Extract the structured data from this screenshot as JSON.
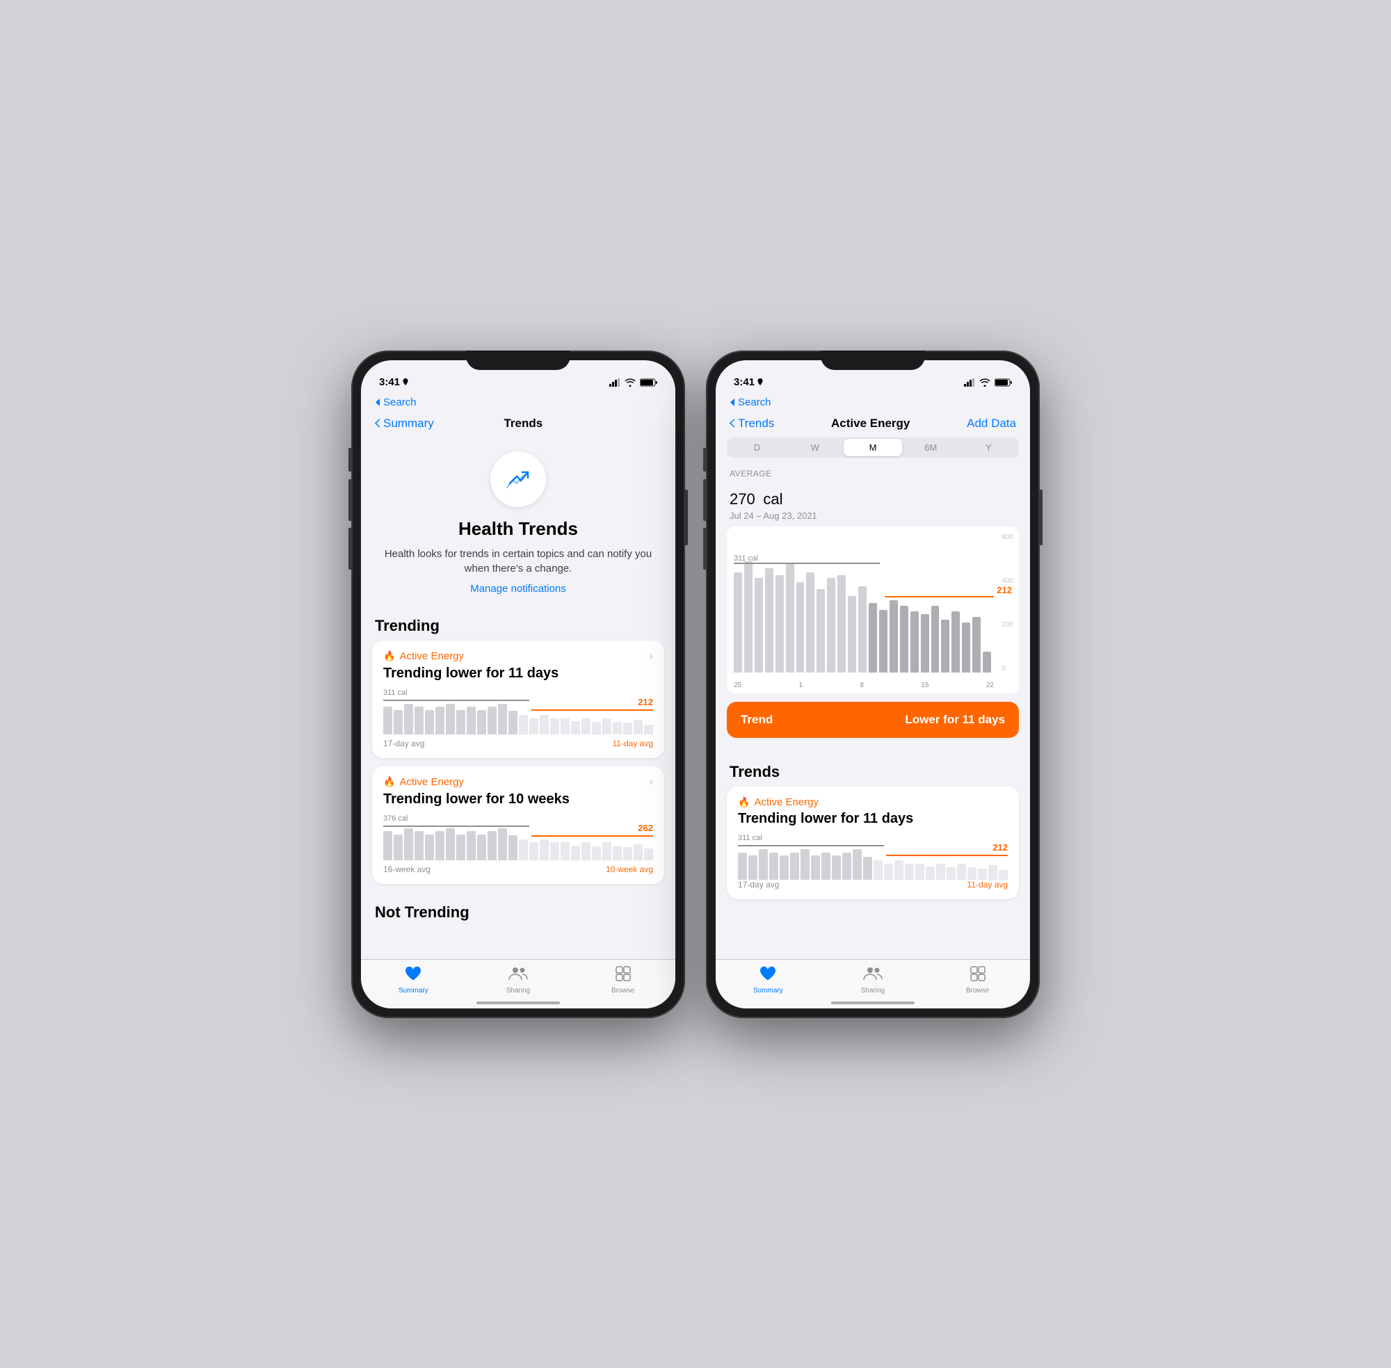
{
  "phone1": {
    "status": {
      "time": "3:41",
      "location_icon": true
    },
    "nav": {
      "back_label": "Summary",
      "title": "Trends"
    },
    "search": {
      "back_label": "Search"
    },
    "hero": {
      "title": "Health Trends",
      "description": "Health looks for trends in certain topics and can notify you when there's a change.",
      "link": "Manage notifications"
    },
    "trending_header": "Trending",
    "cards": [
      {
        "metric": "Active Energy",
        "description": "Trending lower for 11 days",
        "old_cal": "311 cal",
        "new_cal": "212",
        "old_avg": "17-day avg",
        "new_avg": "11-day avg",
        "bars": [
          7,
          6,
          8,
          7,
          6,
          7,
          8,
          6,
          7,
          6,
          7,
          8,
          6,
          5,
          4,
          5,
          4,
          4,
          3,
          4,
          3,
          4,
          3,
          3,
          4,
          3
        ]
      },
      {
        "metric": "Active Energy",
        "description": "Trending lower for 10 weeks",
        "old_cal": "376 cal",
        "new_cal": "262",
        "old_avg": "16-week avg",
        "new_avg": "10-week avg",
        "bars": [
          8,
          7,
          9,
          8,
          7,
          8,
          9,
          7,
          8,
          7,
          8,
          9,
          7,
          6,
          5,
          6,
          5,
          5,
          4,
          5,
          4,
          5,
          4,
          4,
          5,
          4
        ]
      }
    ],
    "not_trending_header": "Not Trending",
    "tabs": [
      {
        "label": "Summary",
        "icon": "heart",
        "active": true
      },
      {
        "label": "Sharing",
        "icon": "person2",
        "active": false
      },
      {
        "label": "Browse",
        "icon": "grid",
        "active": false
      }
    ]
  },
  "phone2": {
    "status": {
      "time": "3:41"
    },
    "nav": {
      "back_label": "Trends",
      "title": "Active Energy",
      "action": "Add Data"
    },
    "segments": [
      "D",
      "W",
      "M",
      "6M",
      "Y"
    ],
    "active_segment": "M",
    "avg": {
      "label": "AVERAGE",
      "value": "270",
      "unit": "cal",
      "range": "Jul 24 – Aug 23, 2021"
    },
    "chart": {
      "old_line_label": "311 cal",
      "new_line_label": "212",
      "y_labels": [
        "600",
        "400",
        "200",
        "0"
      ],
      "x_labels": [
        "25",
        "1",
        "8",
        "15",
        "22"
      ]
    },
    "trend_banner": {
      "left": "Trend",
      "right": "Lower for 11 days"
    },
    "trends_section_header": "Trends",
    "trend_card": {
      "metric": "Active Energy",
      "description": "Trending lower for 11 days",
      "old_cal": "311 cal",
      "new_cal": "212",
      "old_avg": "17-day avg",
      "new_avg": "11-day avg"
    },
    "tabs": [
      {
        "label": "Summary",
        "icon": "heart",
        "active": true
      },
      {
        "label": "Sharing",
        "icon": "person2",
        "active": false
      },
      {
        "label": "Browse",
        "icon": "grid",
        "active": false
      }
    ]
  }
}
